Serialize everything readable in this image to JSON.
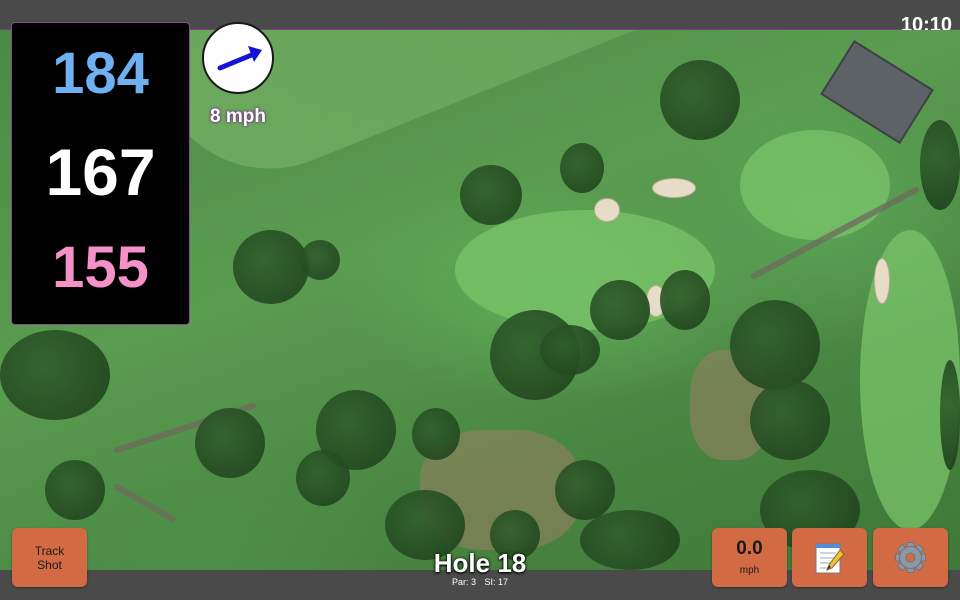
{
  "status": {
    "time": "10:10"
  },
  "yardages": {
    "back": "184",
    "middle": "167",
    "front": "155"
  },
  "wind": {
    "speed": "8 mph",
    "icon": "arrow-icon"
  },
  "buttons": {
    "track_shot_line1": "Track",
    "track_shot_line2": "Shot",
    "speed_value": "0.0",
    "speed_unit": "mph",
    "notes_icon": "notepad-icon",
    "settings_icon": "gear-icon"
  },
  "hole": {
    "title": "Hole 18",
    "par": "Par: 3",
    "si": "SI: 17"
  },
  "colors": {
    "back_yardage": "#6fb0f2",
    "middle_yardage": "#ffffff",
    "front_yardage": "#f590c9",
    "button": "#d26b43",
    "wind_arrow": "#1414d8"
  }
}
